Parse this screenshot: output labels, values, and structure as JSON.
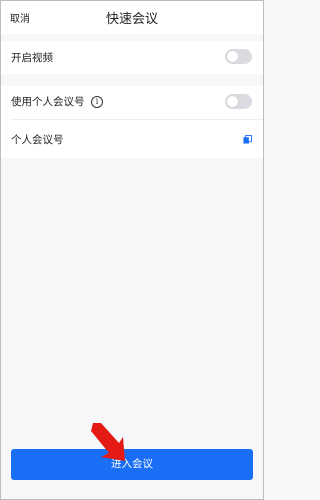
{
  "header": {
    "cancel_label": "取消",
    "title": "快速会议"
  },
  "settings": {
    "video_label": "开启视频",
    "video_on": false,
    "personal_id_label": "使用个人会议号",
    "personal_id_on": false,
    "personal_number_label": "个人会议号"
  },
  "footer": {
    "enter_label": "进入会议"
  },
  "colors": {
    "accent": "#1a6ef5",
    "arrow": "#e31b14"
  },
  "icons": [
    "info-icon",
    "copy-icon",
    "pointer-arrow-icon"
  ]
}
